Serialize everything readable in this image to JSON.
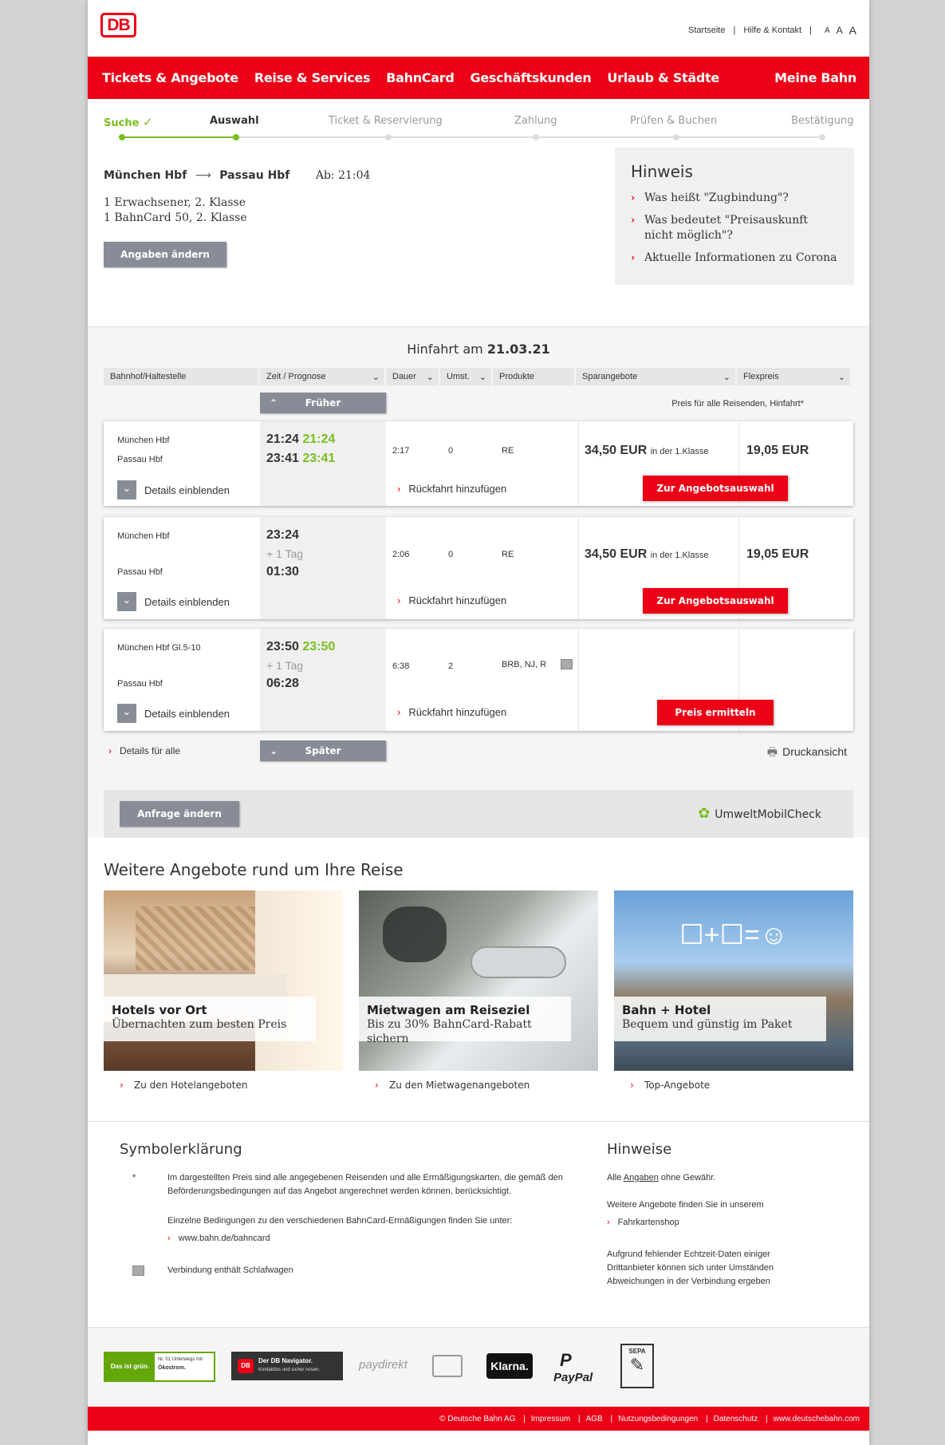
{
  "header": {
    "logo": "DB",
    "links": [
      "Startseite",
      "Hilfe & Kontakt"
    ],
    "font_sizes": [
      "A",
      "A",
      "A"
    ]
  },
  "nav": {
    "items": [
      "Tickets & Angebote",
      "Reise & Services",
      "BahnCard",
      "Geschäftskunden",
      "Urlaub & Städte"
    ],
    "right": "Meine Bahn"
  },
  "steps": [
    "Suche",
    "Auswahl",
    "Ticket & Reservierung",
    "Zahlung",
    "Prüfen & Buchen",
    "Bestätigung"
  ],
  "summary": {
    "from": "München Hbf",
    "to": "Passau Hbf",
    "departure": "Ab: 21:04",
    "traveller1": "1 Erwachsener, 2. Klasse",
    "traveller2": "1 BahnCard 50, 2. Klasse",
    "change_button": "Angaben ändern"
  },
  "hinweis": {
    "title": "Hinweis",
    "items": [
      "Was heißt \"Zugbindung\"?",
      "Was bedeutet \"Preisauskunft nicht möglich\"?",
      "Aktuelle Informationen zu Corona"
    ]
  },
  "results": {
    "title_prefix": "Hinfahrt am",
    "date": "21.03.21",
    "columns": [
      "Bahnhof/Haltestelle",
      "Zeit / Prognose",
      "Dauer",
      "Umst.",
      "Produkte",
      "Sparangebote",
      "Flexpreis"
    ],
    "earlier": "Früher",
    "later": "Später",
    "price_note": "Preis für alle Reisenden, Hinfahrt*",
    "details_all": "Details für alle",
    "print": "Druckansicht",
    "connections": [
      {
        "from": "München Hbf",
        "to": "Passau Hbf",
        "dep": "21:24",
        "dep_rt": "21:24",
        "arr": "23:41",
        "arr_rt": "23:41",
        "plus_day": "",
        "duration": "2:17",
        "changes": "0",
        "products": "RE",
        "spar": "34,50 EUR",
        "spar_note": "in der 1.Klasse",
        "flex": "19,05 EUR",
        "details": "Details einblenden",
        "return": "Rückfahrt hinzufügen",
        "action": "Zur Angebotsauswahl"
      },
      {
        "from": "München Hbf",
        "to": "Passau Hbf",
        "dep": "23:24",
        "dep_rt": "",
        "arr": "01:30",
        "arr_rt": "",
        "plus_day": "+ 1 Tag",
        "duration": "2:06",
        "changes": "0",
        "products": "RE",
        "spar": "34,50 EUR",
        "spar_note": "in der 1.Klasse",
        "flex": "19,05 EUR",
        "details": "Details einblenden",
        "return": "Rückfahrt hinzufügen",
        "action": "Zur Angebotsauswahl"
      },
      {
        "from": "München Hbf Gl.5-10",
        "to": "Passau Hbf",
        "dep": "23:50",
        "dep_rt": "23:50",
        "arr": "06:28",
        "arr_rt": "",
        "plus_day": "+ 1 Tag",
        "duration": "6:38",
        "changes": "2",
        "products": "BRB, NJ, R",
        "spar": "",
        "spar_note": "",
        "flex": "",
        "details": "Details einblenden",
        "return": "Rückfahrt hinzufügen",
        "action": "Preis ermitteln"
      }
    ],
    "change_request": "Anfrage ändern",
    "umwelt": "UmweltMobilCheck"
  },
  "weitere": {
    "title": "Weitere Angebote rund um Ihre Reise",
    "tiles": [
      {
        "title": "Hotels vor Ort",
        "sub": "Übernachten zum besten Preis",
        "link": "Zu den Hotelangeboten"
      },
      {
        "title": "Mietwagen am Reiseziel",
        "sub": "Bis zu 30% BahnCard-Rabatt sichern",
        "link": "Zu den Mietwagenangeboten"
      },
      {
        "title": "Bahn + Hotel",
        "sub": "Bequem und günstig im Paket",
        "link": "Top-Angebote"
      }
    ]
  },
  "legend": {
    "title": "Symbolerklärung",
    "star": "*",
    "text1": "Im dargestellten Preis sind alle angegebenen Reisenden und alle Ermäßigungskarten, die gemäß den Beförderungsbedingungen auf das Angebot angerechnet werden können, berücksichtigt.",
    "text2": "Einzelne Bedingungen zu den verschiedenen BahnCard-Ermäßigungen finden Sie unter:",
    "link": "www.bahn.de/bahncard",
    "sleeper": "Verbindung enthält Schlafwagen"
  },
  "hinweise": {
    "title": "Hinweise",
    "line1_pre": "Alle",
    "line1_link": "Angaben",
    "line1_post": "ohne Gewähr.",
    "line2": "Weitere Angebote finden Sie in unserem",
    "link": "Fahrkartenshop",
    "line3": "Aufgrund fehlender Echtzeit-Daten einiger Drittanbieter können sich unter Umständen Abweichungen in der Verbindung ergeben"
  },
  "footer_logos": {
    "green1": "Das ist grün.",
    "green2": "Nr. 01 Unterwegs mit",
    "green3": "Ökostrom.",
    "navigator1": "Der DB Navigator.",
    "navigator2": "Kontaktlos und sicher reisen.",
    "paydirekt": "paydirekt",
    "klarna": "Klarna.",
    "paypal": "PayPal",
    "sepa": "SEPA"
  },
  "footer": [
    "© Deutsche Bahn AG",
    "Impressum",
    "AGB",
    "Nutzungsbedingungen",
    "Datenschutz",
    "www.deutschebahn.com"
  ]
}
